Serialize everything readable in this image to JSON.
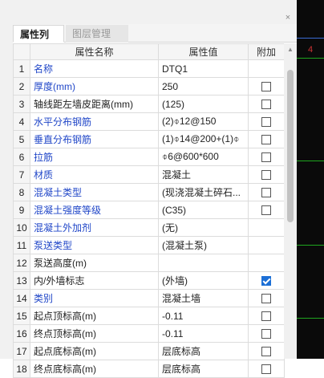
{
  "panel": {
    "close_glyph": "×"
  },
  "tabs": [
    {
      "label": "属性列表",
      "active": true
    },
    {
      "label": "图层管理",
      "active": false
    }
  ],
  "columns": {
    "name": "属性名称",
    "value": "属性值",
    "add": "附加"
  },
  "rows": [
    {
      "num": "1",
      "name": "名称",
      "value": "DTQ1",
      "blue": true,
      "checked": null
    },
    {
      "num": "2",
      "name": "厚度(mm)",
      "value": "250",
      "blue": true,
      "checked": false
    },
    {
      "num": "3",
      "name": "轴线距左墙皮距离(mm)",
      "value": "(125)",
      "blue": false,
      "checked": false
    },
    {
      "num": "4",
      "name": "水平分布钢筋",
      "value": "(2)⌽12@150",
      "blue": true,
      "checked": false
    },
    {
      "num": "5",
      "name": "垂直分布钢筋",
      "value": "(1)⌽14@200+(1)⌽",
      "blue": true,
      "checked": false
    },
    {
      "num": "6",
      "name": "拉筋",
      "value": "⌽6@600*600",
      "blue": true,
      "checked": false
    },
    {
      "num": "7",
      "name": "材质",
      "value": "混凝土",
      "blue": true,
      "checked": false
    },
    {
      "num": "8",
      "name": "混凝土类型",
      "value": "(现浇混凝土碎石...",
      "blue": true,
      "checked": false
    },
    {
      "num": "9",
      "name": "混凝土强度等级",
      "value": "(C35)",
      "blue": true,
      "checked": false
    },
    {
      "num": "10",
      "name": "混凝土外加剂",
      "value": "(无)",
      "blue": true,
      "checked": null
    },
    {
      "num": "11",
      "name": "泵送类型",
      "value": "(混凝土泵)",
      "blue": true,
      "checked": null
    },
    {
      "num": "12",
      "name": "泵送高度(m)",
      "value": "",
      "blue": false,
      "checked": null
    },
    {
      "num": "13",
      "name": "内/外墙标志",
      "value": "(外墙)",
      "blue": false,
      "checked": true
    },
    {
      "num": "14",
      "name": "类别",
      "value": "混凝土墙",
      "blue": true,
      "checked": false
    },
    {
      "num": "15",
      "name": "起点顶标高(m)",
      "value": "-0.11",
      "blue": false,
      "checked": false
    },
    {
      "num": "16",
      "name": "终点顶标高(m)",
      "value": "-0.11",
      "blue": false,
      "checked": false
    },
    {
      "num": "17",
      "name": "起点底标高(m)",
      "value": "层底标高",
      "blue": false,
      "checked": false
    },
    {
      "num": "18",
      "name": "终点底标高(m)",
      "value": "层底标高",
      "blue": false,
      "checked": false
    }
  ],
  "right_view": {
    "background": "#0a0a0a",
    "line_colors": [
      "#3a6bd4",
      "#1fa51f",
      "#1fa51f",
      "#1fa51f",
      "#1fa51f"
    ],
    "marker": "4"
  }
}
